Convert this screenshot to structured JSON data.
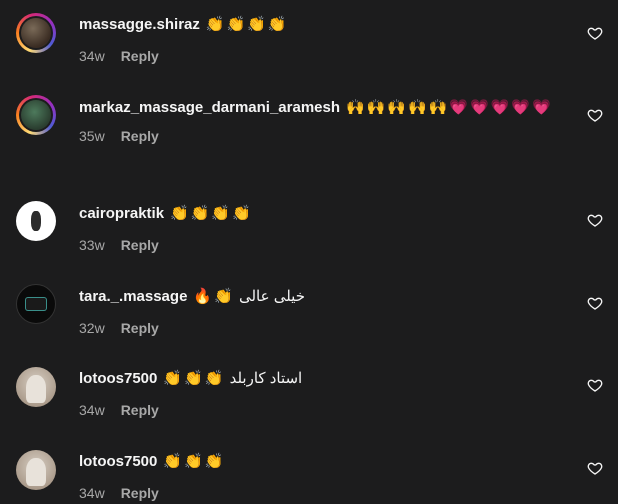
{
  "comments": [
    {
      "username": "massagge.shiraz",
      "emojis": "👏👏👏👏",
      "text": "",
      "time": "34w",
      "reply_label": "Reply"
    },
    {
      "username": "markaz_massage_darmani_aramesh",
      "emojis": "🙌🙌🙌🙌🙌💗💗💗💗💗",
      "text": "",
      "time": "35w",
      "reply_label": "Reply"
    },
    {
      "username": "cairopraktik",
      "emojis": "👏👏👏👏",
      "text": "",
      "time": "33w",
      "reply_label": "Reply"
    },
    {
      "username": "tara._.massage",
      "emojis": "🔥👏",
      "text": "خیلی عالی",
      "time": "32w",
      "reply_label": "Reply"
    },
    {
      "username": "lotoos7500",
      "emojis": "👏👏👏",
      "text": "استاد کاربلد",
      "time": "34w",
      "reply_label": "Reply"
    },
    {
      "username": "lotoos7500",
      "emojis": "👏👏👏",
      "text": "",
      "time": "34w",
      "reply_label": "Reply"
    }
  ],
  "icons": {
    "like": "heart-outline-icon"
  },
  "colors": {
    "background": "#1c1c1d",
    "text": "#f5f5f5",
    "muted": "#a8a8a8"
  }
}
